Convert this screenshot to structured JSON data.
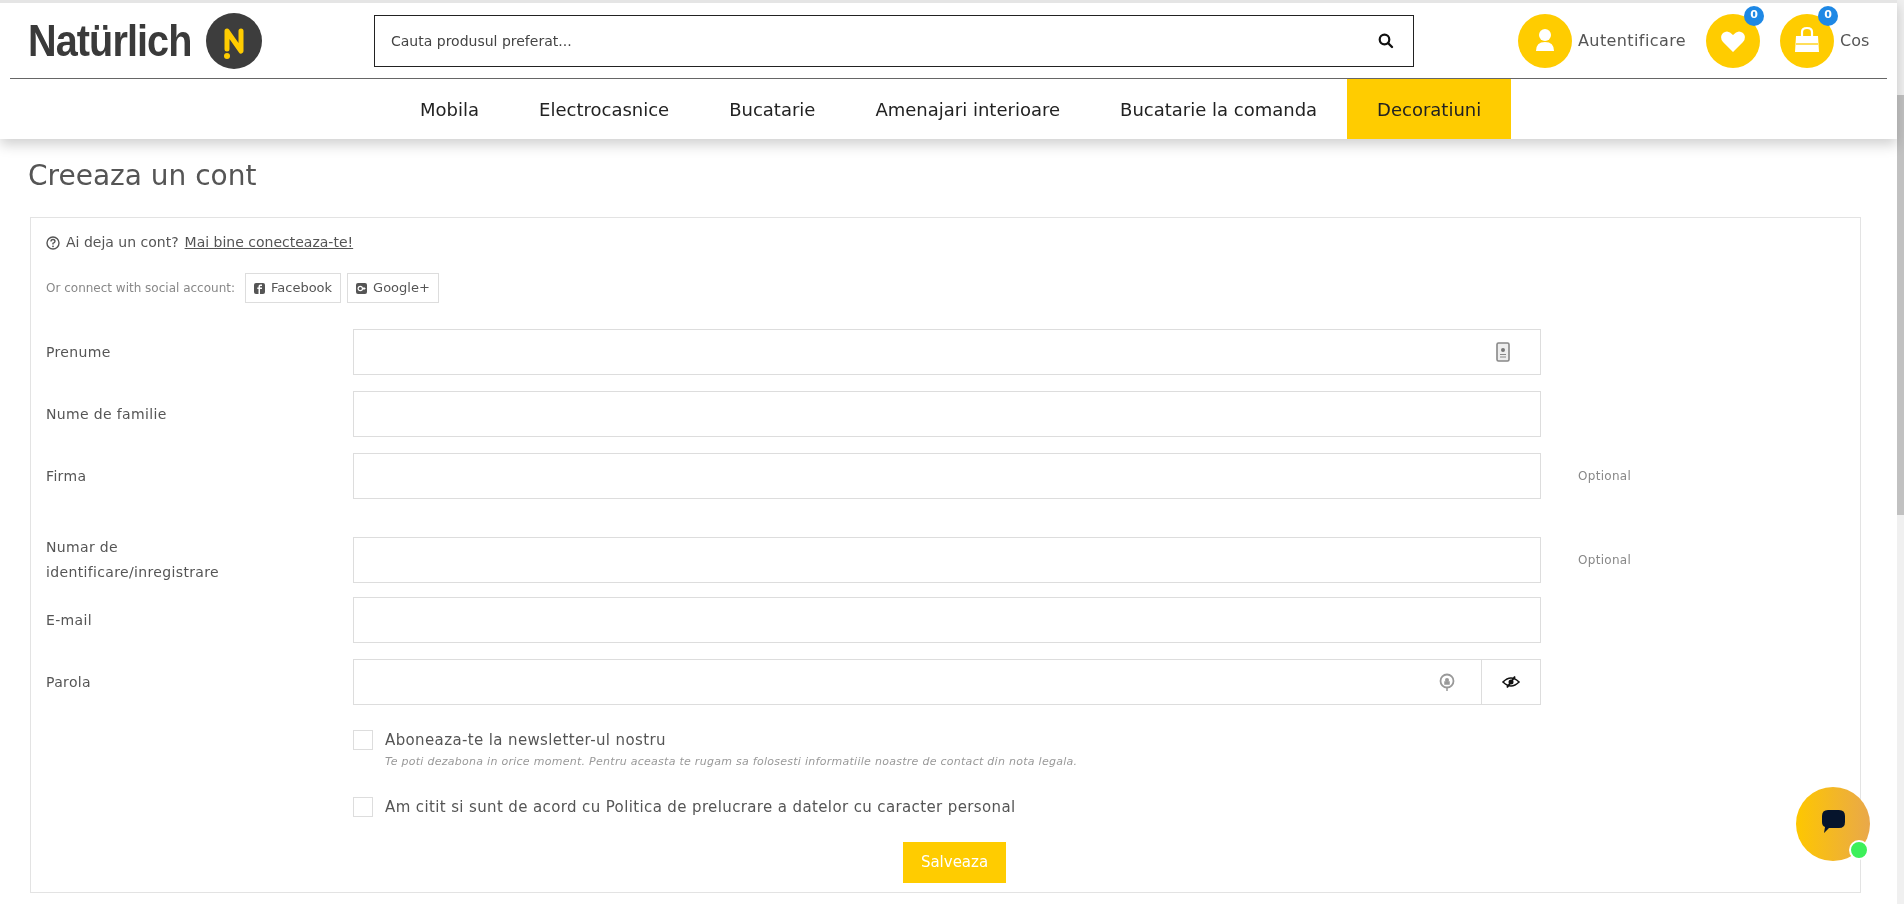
{
  "header": {
    "logo": "Natürlich",
    "search": {
      "placeholder": "Cauta produsul preferat..."
    },
    "account": {
      "label": "Autentificare"
    },
    "wishlist": {
      "count": "0"
    },
    "cart": {
      "count": "0",
      "label": "Cos"
    }
  },
  "nav": [
    {
      "label": "Mobila",
      "selected": false
    },
    {
      "label": "Electrocasnice",
      "selected": false
    },
    {
      "label": "Bucatarie",
      "selected": false
    },
    {
      "label": "Amenajari interioare",
      "selected": false
    },
    {
      "label": "Bucatarie la comanda",
      "selected": false
    },
    {
      "label": "Decoratiuni",
      "selected": true
    }
  ],
  "page_title": "Creeaza un cont",
  "form": {
    "have_account": "Ai deja un cont?",
    "login_link": "Mai bine conecteaza-te!",
    "social_label": "Or connect with social account:",
    "social_buttons": [
      {
        "kind": "facebook",
        "label": "Facebook"
      },
      {
        "kind": "google",
        "label": "Google+"
      }
    ],
    "fields": [
      {
        "kind": "contact",
        "label": "Prenume"
      },
      {
        "kind": "text",
        "label": "Nume de familie"
      },
      {
        "kind": "text",
        "label": "Firma",
        "note": "Optional"
      },
      {
        "kind": "text",
        "label": "Numar de identificare/inregistrare",
        "note": "Optional"
      },
      {
        "kind": "text",
        "label": "E-mail"
      },
      {
        "kind": "password",
        "label": "Parola"
      }
    ],
    "checkboxes": [
      {
        "label": "Aboneaza-te la newsletter-ul nostru",
        "hint": "Te poti dezabona in orice moment. Pentru aceasta te rugam sa folosesti informatiile noastre de contact din nota legala.",
        "checked": false
      },
      {
        "label": "Am citit si sunt de acord cu Politica de prelucrare a datelor cu caracter personal",
        "checked": false
      }
    ],
    "submit": "Salveaza"
  }
}
